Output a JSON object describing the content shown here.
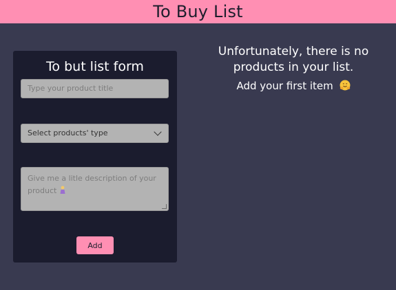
{
  "header": {
    "title": "To Buy List"
  },
  "form": {
    "title": "To but list form",
    "product_title_placeholder": "Type your product title",
    "product_type_selected": "Select products' type",
    "description_placeholder_text": "Give me a litle description of your product",
    "add_label": "Add"
  },
  "empty_state": {
    "line1": "Unfortunately, there is no",
    "line2": "products in your list.",
    "cta": "Add your first item",
    "icon": "hugging-face-emoji"
  },
  "colors": {
    "background": "#393a50",
    "header": "#ff8fb3",
    "form_card": "#1b1c2e",
    "field": "#b3b3b3",
    "button": "#ff8fb3"
  }
}
